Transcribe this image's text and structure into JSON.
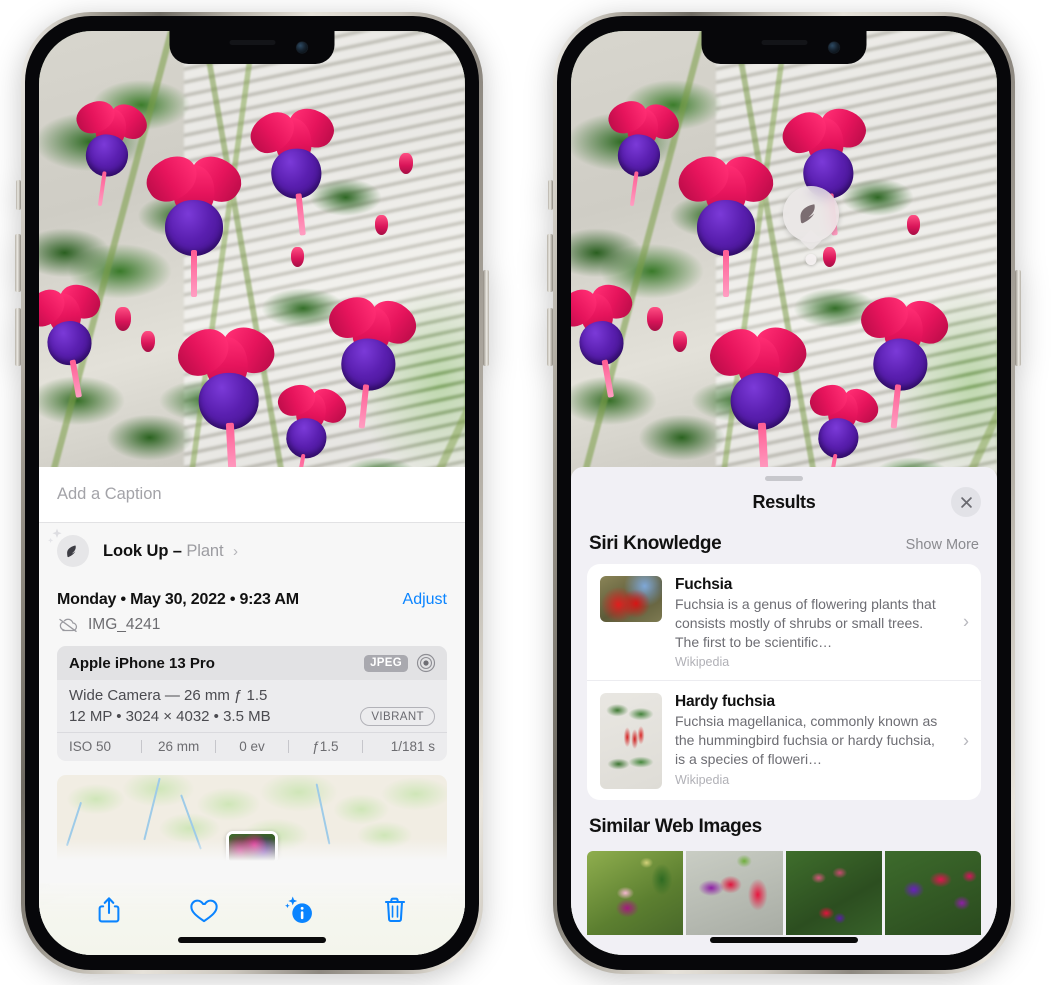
{
  "left_phone": {
    "caption": {
      "placeholder": "Add a Caption",
      "value": ""
    },
    "lookup": {
      "label": "Look Up",
      "dash": "–",
      "subject": "Plant",
      "chevron": "›",
      "icon": "leaf-icon"
    },
    "metadata": {
      "date": "Monday • May 30, 2022 • 9:23 AM",
      "adjust_label": "Adjust",
      "filename": "IMG_4241",
      "cloud_icon": "cloud-slash-icon"
    },
    "exif": {
      "device": "Apple iPhone 13 Pro",
      "format_badge": "JPEG",
      "lens_icon": "lens-circle-icon",
      "lens": "Wide Camera — 26 mm ƒ 1.5",
      "resolution": "12 MP • 3024 × 4032 • 3.5 MB",
      "style_badge": "VIBRANT",
      "stats": [
        "ISO 50",
        "26 mm",
        "0 ev",
        "ƒ1.5",
        "1/181 s"
      ]
    },
    "toolbar": [
      {
        "name": "share-icon",
        "label": "Share"
      },
      {
        "name": "heart-icon",
        "label": "Favorite"
      },
      {
        "name": "info-sparkle-icon",
        "label": "Info"
      },
      {
        "name": "trash-icon",
        "label": "Delete"
      }
    ]
  },
  "right_phone": {
    "badge": {
      "icon": "leaf-icon"
    },
    "sheet": {
      "title": "Results",
      "close_icon": "close-icon",
      "sections": [
        {
          "title": "Siri Knowledge",
          "action": "Show More",
          "items": [
            {
              "title": "Fuchsia",
              "description": "Fuchsia is a genus of flowering plants that consists mostly of shrubs or small trees. The first to be scientific…",
              "source": "Wikipedia",
              "chevron": "›"
            },
            {
              "title": "Hardy fuchsia",
              "description": "Fuchsia magellanica, commonly known as the hummingbird fuchsia or hardy fuchsia, is a species of floweri…",
              "source": "Wikipedia",
              "chevron": "›"
            }
          ]
        },
        {
          "title": "Similar Web Images",
          "action": "",
          "thumbnails": [
            "web-image-1",
            "web-image-2",
            "web-image-3",
            "web-image-4"
          ]
        }
      ]
    }
  },
  "colors": {
    "accent_blue": "#0a84ff",
    "sheet_bg": "#f1f0f5",
    "info_bg": "#f7f7f7",
    "card_white": "#ffffff",
    "secondary_text": "#6d6d73",
    "muted_text": "#b0b0b6",
    "badge_gray": "#a9a9af"
  }
}
